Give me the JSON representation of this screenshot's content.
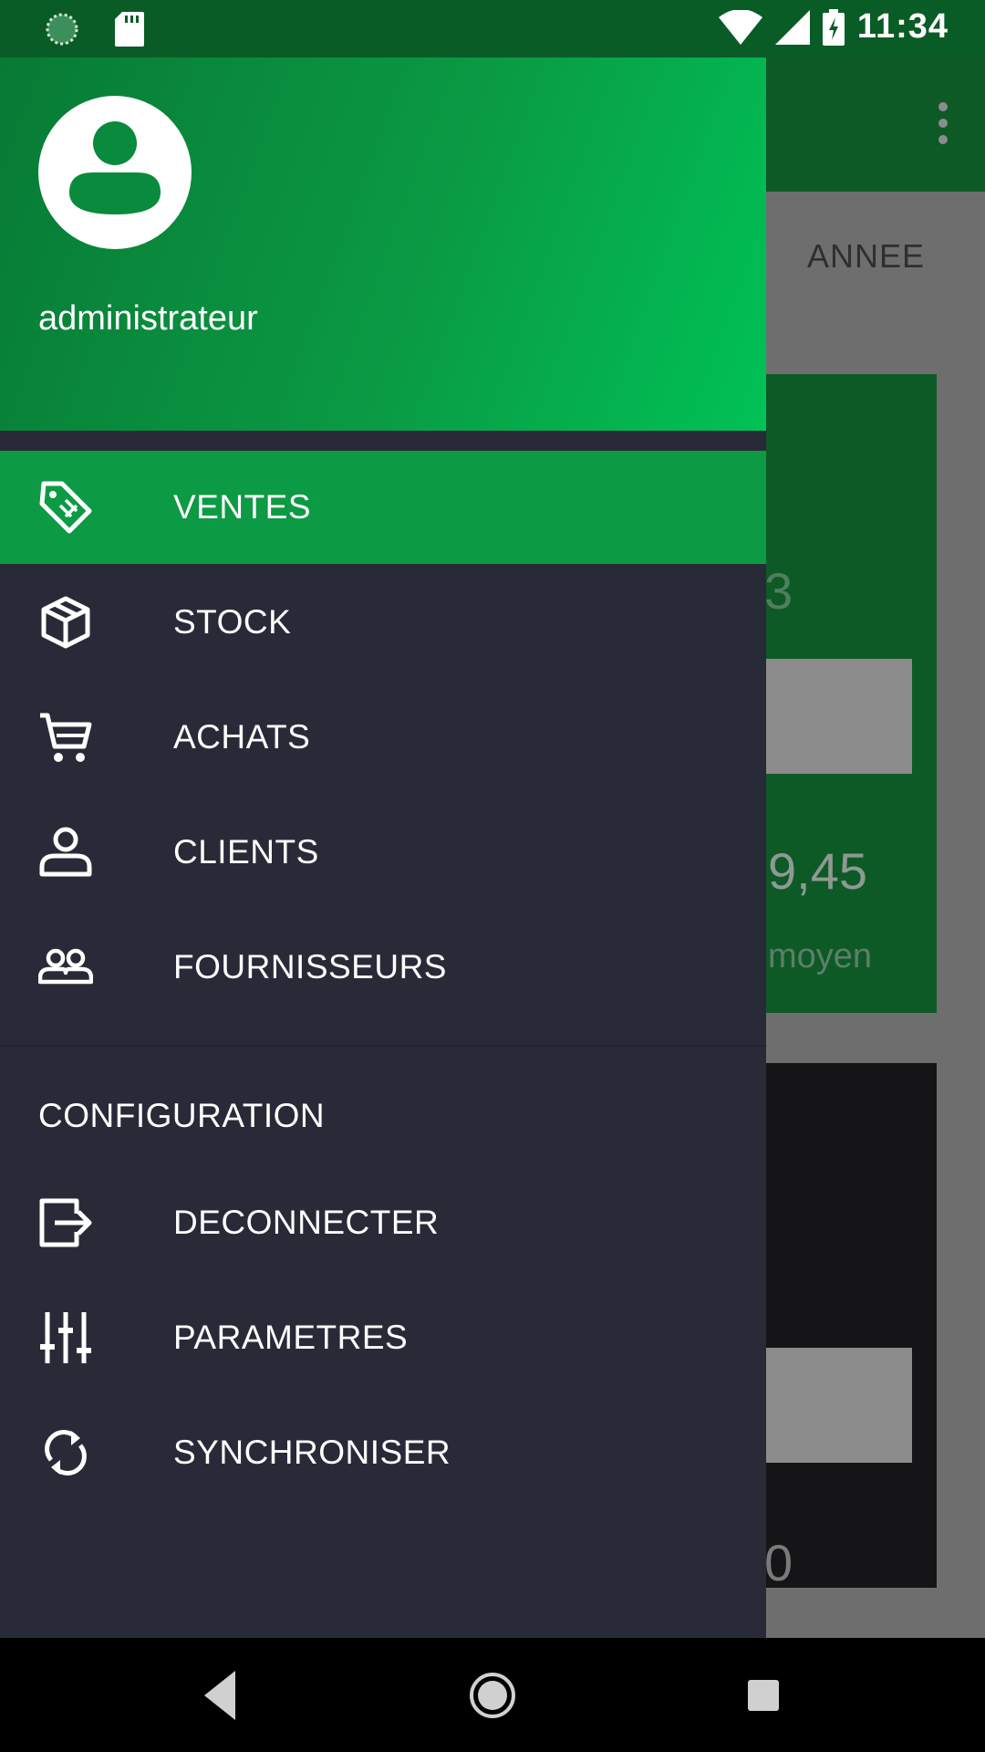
{
  "status_bar": {
    "time": "11:34"
  },
  "background": {
    "tab_label": "ANNEE",
    "value_1": "3",
    "value_2": "9,45",
    "value_2_caption": "moyen",
    "value_3": "0"
  },
  "drawer": {
    "user": {
      "name": "administrateur"
    },
    "menu": [
      {
        "label": "VENTES",
        "icon": "tag-icon",
        "active": true
      },
      {
        "label": "STOCK",
        "icon": "box-icon",
        "active": false
      },
      {
        "label": "ACHATS",
        "icon": "cart-icon",
        "active": false
      },
      {
        "label": "CLIENTS",
        "icon": "person-icon",
        "active": false
      },
      {
        "label": "FOURNISSEURS",
        "icon": "people-icon",
        "active": false
      }
    ],
    "config_section": {
      "title": "CONFIGURATION",
      "items": [
        {
          "label": "DECONNECTER",
          "icon": "logout-icon"
        },
        {
          "label": "PARAMETRES",
          "icon": "sliders-icon"
        },
        {
          "label": "SYNCHRONISER",
          "icon": "sync-icon"
        }
      ]
    }
  },
  "colors": {
    "drawer_bg": "#282b37",
    "active_item": "#0d9a45",
    "header_gradient_start": "#087a35",
    "header_gradient_end": "#00c256",
    "status_bar": "#0a5c27"
  }
}
